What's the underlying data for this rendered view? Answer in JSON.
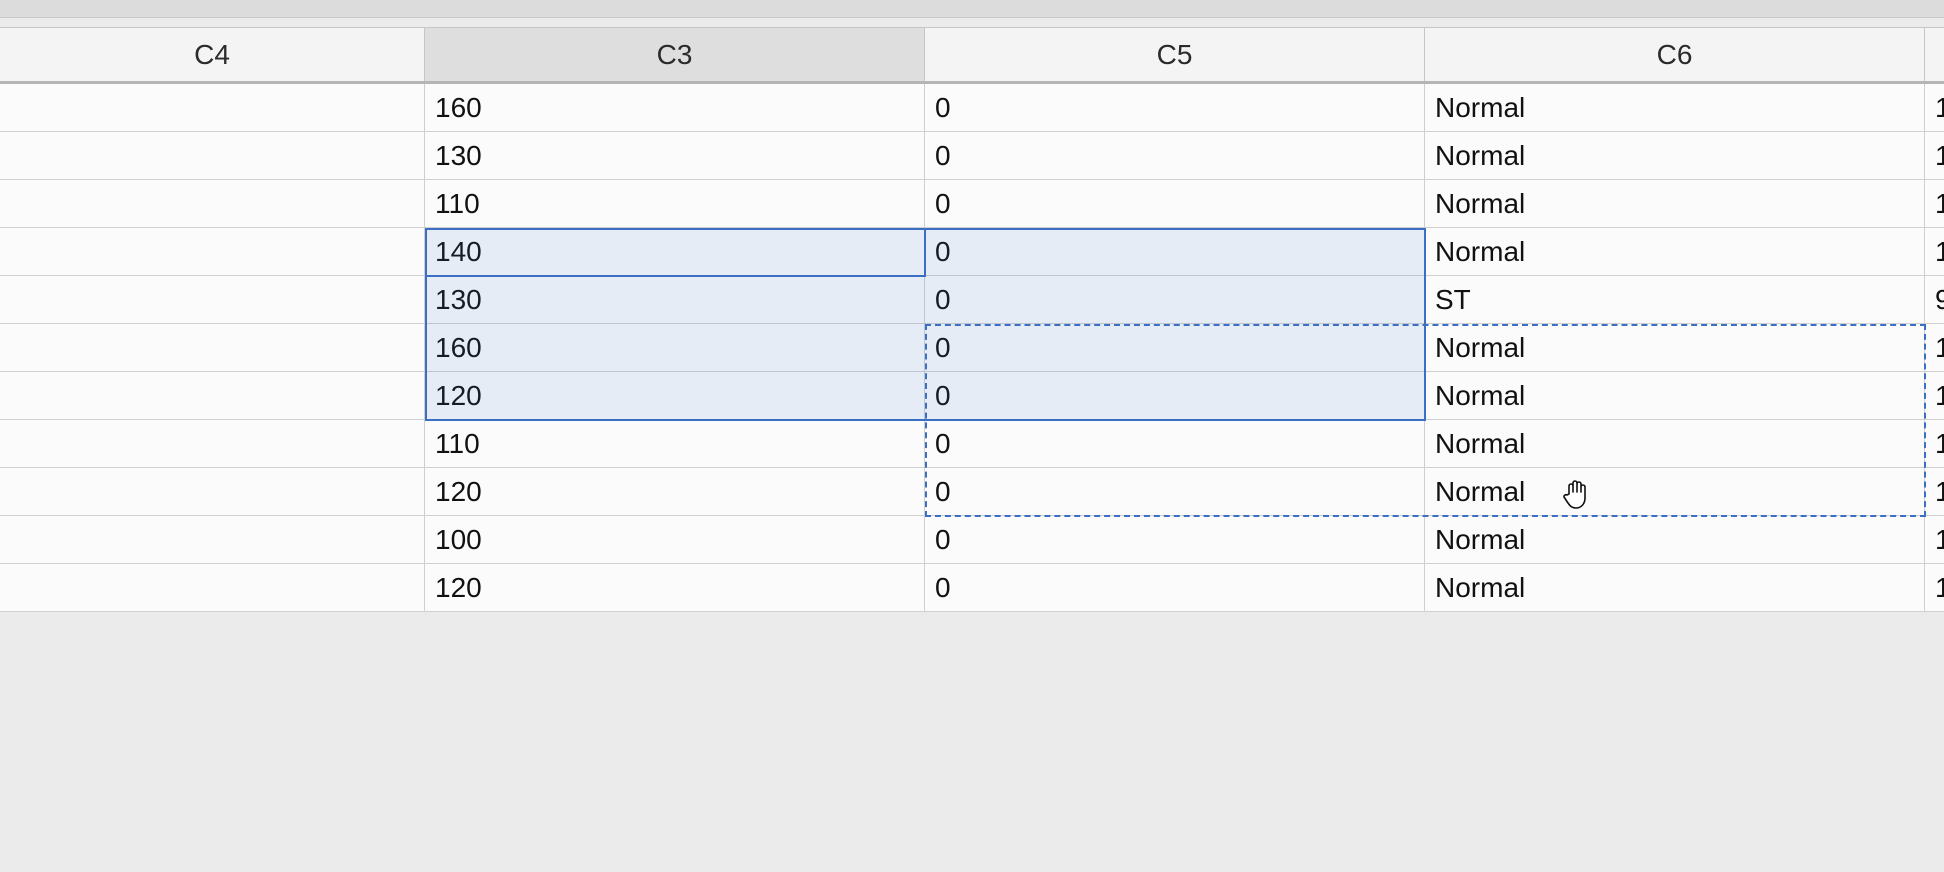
{
  "columns": [
    {
      "key": "c4",
      "label": "C4"
    },
    {
      "key": "c3",
      "label": "C3",
      "sorted": true
    },
    {
      "key": "c5",
      "label": "C5"
    },
    {
      "key": "c6",
      "label": "C6"
    },
    {
      "key": "c7",
      "label": ""
    }
  ],
  "rows": [
    {
      "c4": "",
      "c3": "160",
      "c5": "0",
      "c6": "Normal",
      "c7": "1"
    },
    {
      "c4": "",
      "c3": "130",
      "c5": "0",
      "c6": "Normal",
      "c7": "1"
    },
    {
      "c4": "",
      "c3": "110",
      "c5": "0",
      "c6": "Normal",
      "c7": "1"
    },
    {
      "c4": "",
      "c3": "140",
      "c5": "0",
      "c6": "Normal",
      "c7": "1"
    },
    {
      "c4": "",
      "c3": "130",
      "c5": "0",
      "c6": "ST",
      "c7": "9"
    },
    {
      "c4": "",
      "c3": "160",
      "c5": "0",
      "c6": "Normal",
      "c7": "1"
    },
    {
      "c4": "",
      "c3": "120",
      "c5": "0",
      "c6": "Normal",
      "c7": "1"
    },
    {
      "c4": "",
      "c3": "110",
      "c5": "0",
      "c6": "Normal",
      "c7": "1"
    },
    {
      "c4": "",
      "c3": "120",
      "c5": "0",
      "c6": "Normal",
      "c7": "1"
    },
    {
      "c4": "",
      "c3": "100",
      "c5": "0",
      "c6": "Normal",
      "c7": "1"
    },
    {
      "c4": "",
      "c3": "120",
      "c5": "0",
      "c6": "Normal",
      "c7": "1"
    }
  ],
  "cursor": {
    "icon": "open-hand-cursor-icon"
  },
  "colors": {
    "selection_border": "#3a6fc4",
    "selection_fill": "#e6eef9"
  }
}
